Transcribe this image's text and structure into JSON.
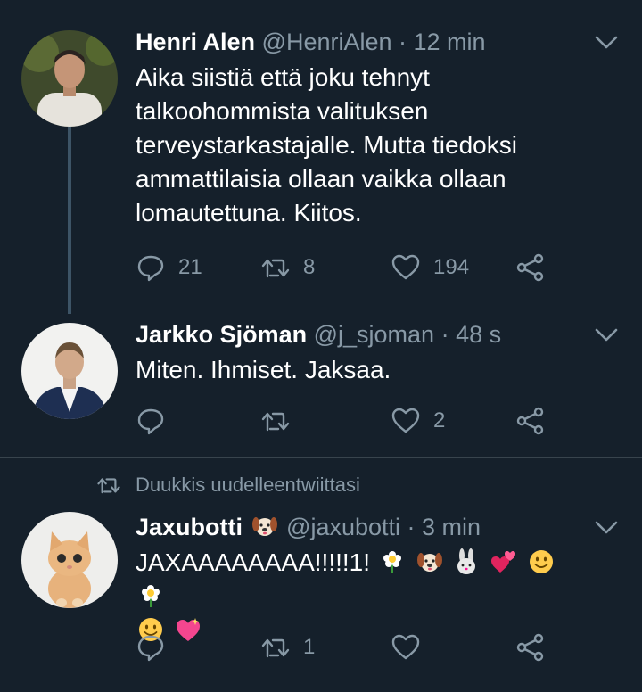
{
  "tweets": [
    {
      "name": "Henri Alen",
      "handle": "@HenriAlen",
      "time": "· 12 min",
      "text": "Aika siistiä että joku tehnyt talkoohommista valituksen terveystarkastajalle. Mutta tiedoksi ammattilaisia ollaan vaikka ollaan lomautettuna. Kiitos.",
      "replies": "21",
      "retweets": "8",
      "likes": "194"
    },
    {
      "name": "Jarkko Sjöman",
      "handle": "@j_sjoman",
      "time": "· 48 s",
      "text": "Miten. Ihmiset. Jaksaa.",
      "replies": "",
      "retweets": "",
      "likes": "2"
    },
    {
      "retweet_label": "Duukkis uudelleentwiittasi",
      "name": "Jaxubotti",
      "handle": "@jaxubotti",
      "time": "· 3 min",
      "text": "JAXAAAAAAAA!!!!!1!",
      "replies": "",
      "retweets": "1",
      "likes": ""
    }
  ],
  "colors": {
    "background": "#15202b",
    "muted": "#8899a6",
    "divider": "#38444d",
    "thread_line": "#3d5466"
  }
}
